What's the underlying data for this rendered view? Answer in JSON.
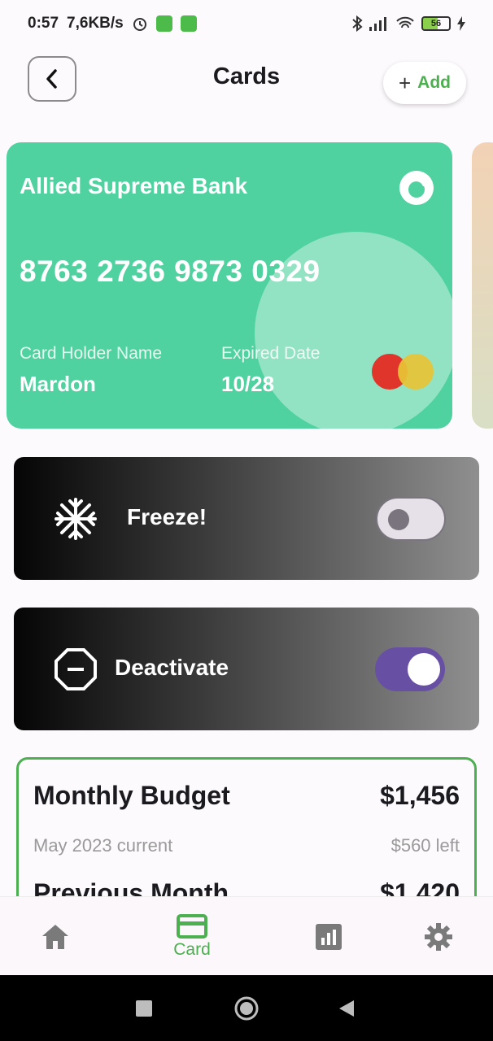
{
  "status_bar": {
    "time": "0:57",
    "speed": "7,6KB/s",
    "battery": "56"
  },
  "header": {
    "title": "Cards",
    "add_label": "Add",
    "add_plus": "+"
  },
  "card": {
    "bank_name": "Allied Supreme Bank",
    "number": "8763 2736 9873 0329",
    "holder_label": "Card Holder Name",
    "holder_value": "Mardon",
    "expiry_label": "Expired Date",
    "expiry_value": "10/28",
    "color": "#4fd1a0"
  },
  "actions": {
    "freeze": {
      "label": "Freeze!",
      "enabled": false,
      "icon": "snowflake-icon"
    },
    "deactivate": {
      "label": "Deactivate",
      "enabled": true,
      "icon": "stop-sign-icon"
    }
  },
  "budget": {
    "monthly_title": "Monthly Budget",
    "monthly_amount": "$1,456",
    "period": "May 2023 current",
    "left": "$560 left",
    "previous_title": "Previous Month",
    "previous_amount": "$1,420"
  },
  "bottom_nav": {
    "items": [
      {
        "name": "home",
        "icon": "home-icon",
        "label": ""
      },
      {
        "name": "card",
        "icon": "card-icon",
        "label": "Card",
        "active": true
      },
      {
        "name": "stats",
        "icon": "chart-icon",
        "label": ""
      },
      {
        "name": "settings",
        "icon": "gear-icon",
        "label": ""
      }
    ]
  },
  "colors": {
    "accent": "#4caf50",
    "toggle_on": "#6750a4"
  }
}
